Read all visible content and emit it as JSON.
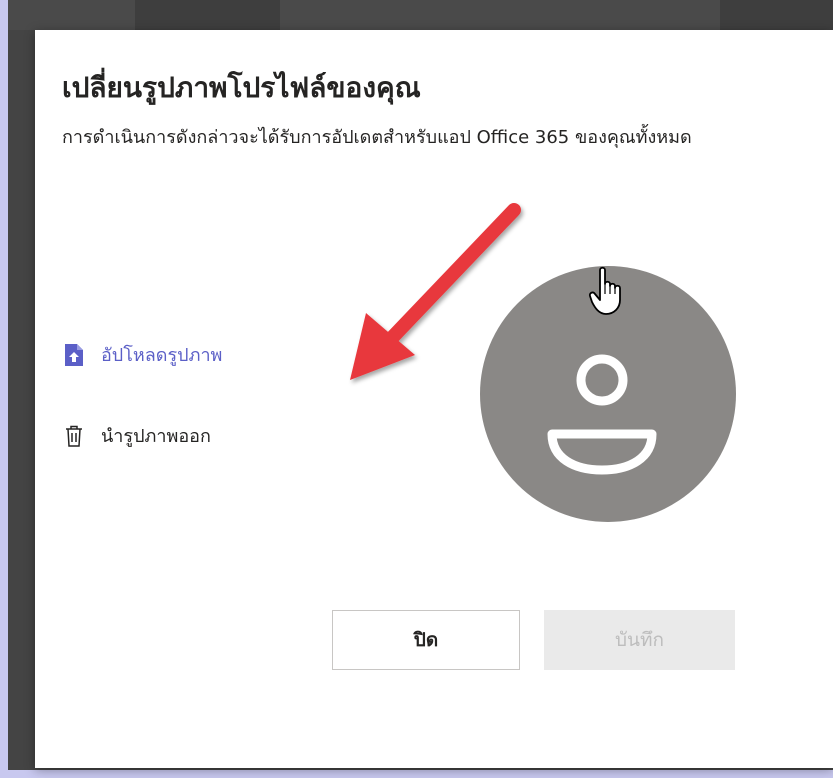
{
  "dialog": {
    "title": "เปลี่ยนรูปภาพโปรไฟล์ของคุณ",
    "subtitle": "การดำเนินการดังกล่าวจะได้รับการอัปเดตสำหรับแอป Office 365 ของคุณทั้งหมด"
  },
  "actions": {
    "upload_label": "อัปโหลดรูปภาพ",
    "remove_label": "นำรูปภาพออก"
  },
  "buttons": {
    "close_label": "ปิด",
    "save_label": "บันทึก"
  },
  "colors": {
    "accent": "#5b5fc7",
    "annotation_arrow": "#e8383d",
    "avatar_bg": "#8a8886"
  },
  "icons": {
    "upload": "upload-file-icon",
    "remove": "trash-icon",
    "avatar": "person-icon",
    "pointer": "hand-cursor-icon"
  }
}
